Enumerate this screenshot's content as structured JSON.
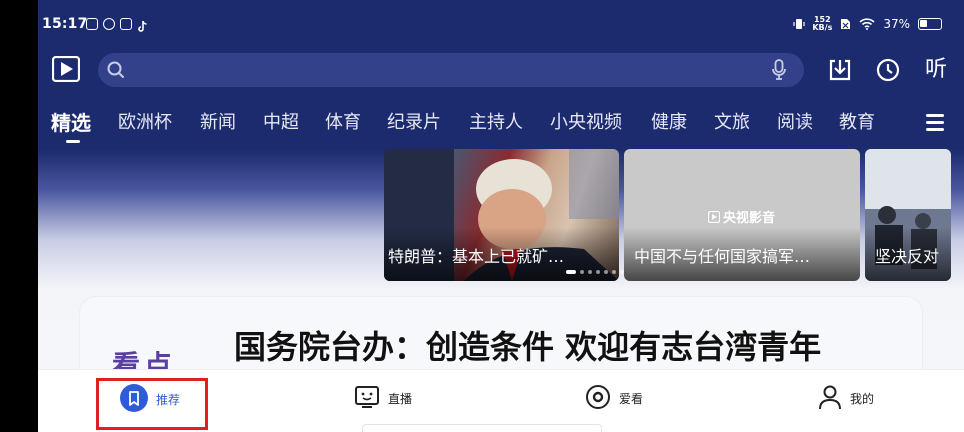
{
  "status_bar": {
    "time": "15:17",
    "net_speed_value": "152",
    "net_speed_unit": "KB/s",
    "battery": "37%"
  },
  "search": {
    "placeholder": ""
  },
  "toolbar": {
    "listen_label": "听"
  },
  "tabs": [
    {
      "label": "精选",
      "active": true
    },
    {
      "label": "欧洲杯"
    },
    {
      "label": "新闻"
    },
    {
      "label": "中超"
    },
    {
      "label": "体育"
    },
    {
      "label": "纪录片"
    },
    {
      "label": "主持人"
    },
    {
      "label": "小央视频"
    },
    {
      "label": "健康"
    },
    {
      "label": "文旅"
    },
    {
      "label": "阅读"
    },
    {
      "label": "教育"
    }
  ],
  "carousel": {
    "cards": [
      {
        "caption": "特朗普：基本上已就矿…"
      },
      {
        "caption": "中国不与任何国家搞军…",
        "watermark": "央视影音"
      },
      {
        "caption": "坚决反对"
      }
    ]
  },
  "headline": {
    "text": "国务院台办：创造条件 欢迎有志台湾青年",
    "deco_text": "看点"
  },
  "bottom_nav": [
    {
      "label": "推荐",
      "icon": "bookmark-icon",
      "active": true
    },
    {
      "label": "直播",
      "icon": "tv-face-icon"
    },
    {
      "label": "爱看",
      "icon": "target-icon"
    },
    {
      "label": "我的",
      "icon": "person-icon"
    }
  ],
  "colors": {
    "header_bg": "#1c2a6e",
    "search_bg": "#33418a",
    "accent_blue": "#2e5bd8",
    "highlight_red": "#e02020"
  }
}
